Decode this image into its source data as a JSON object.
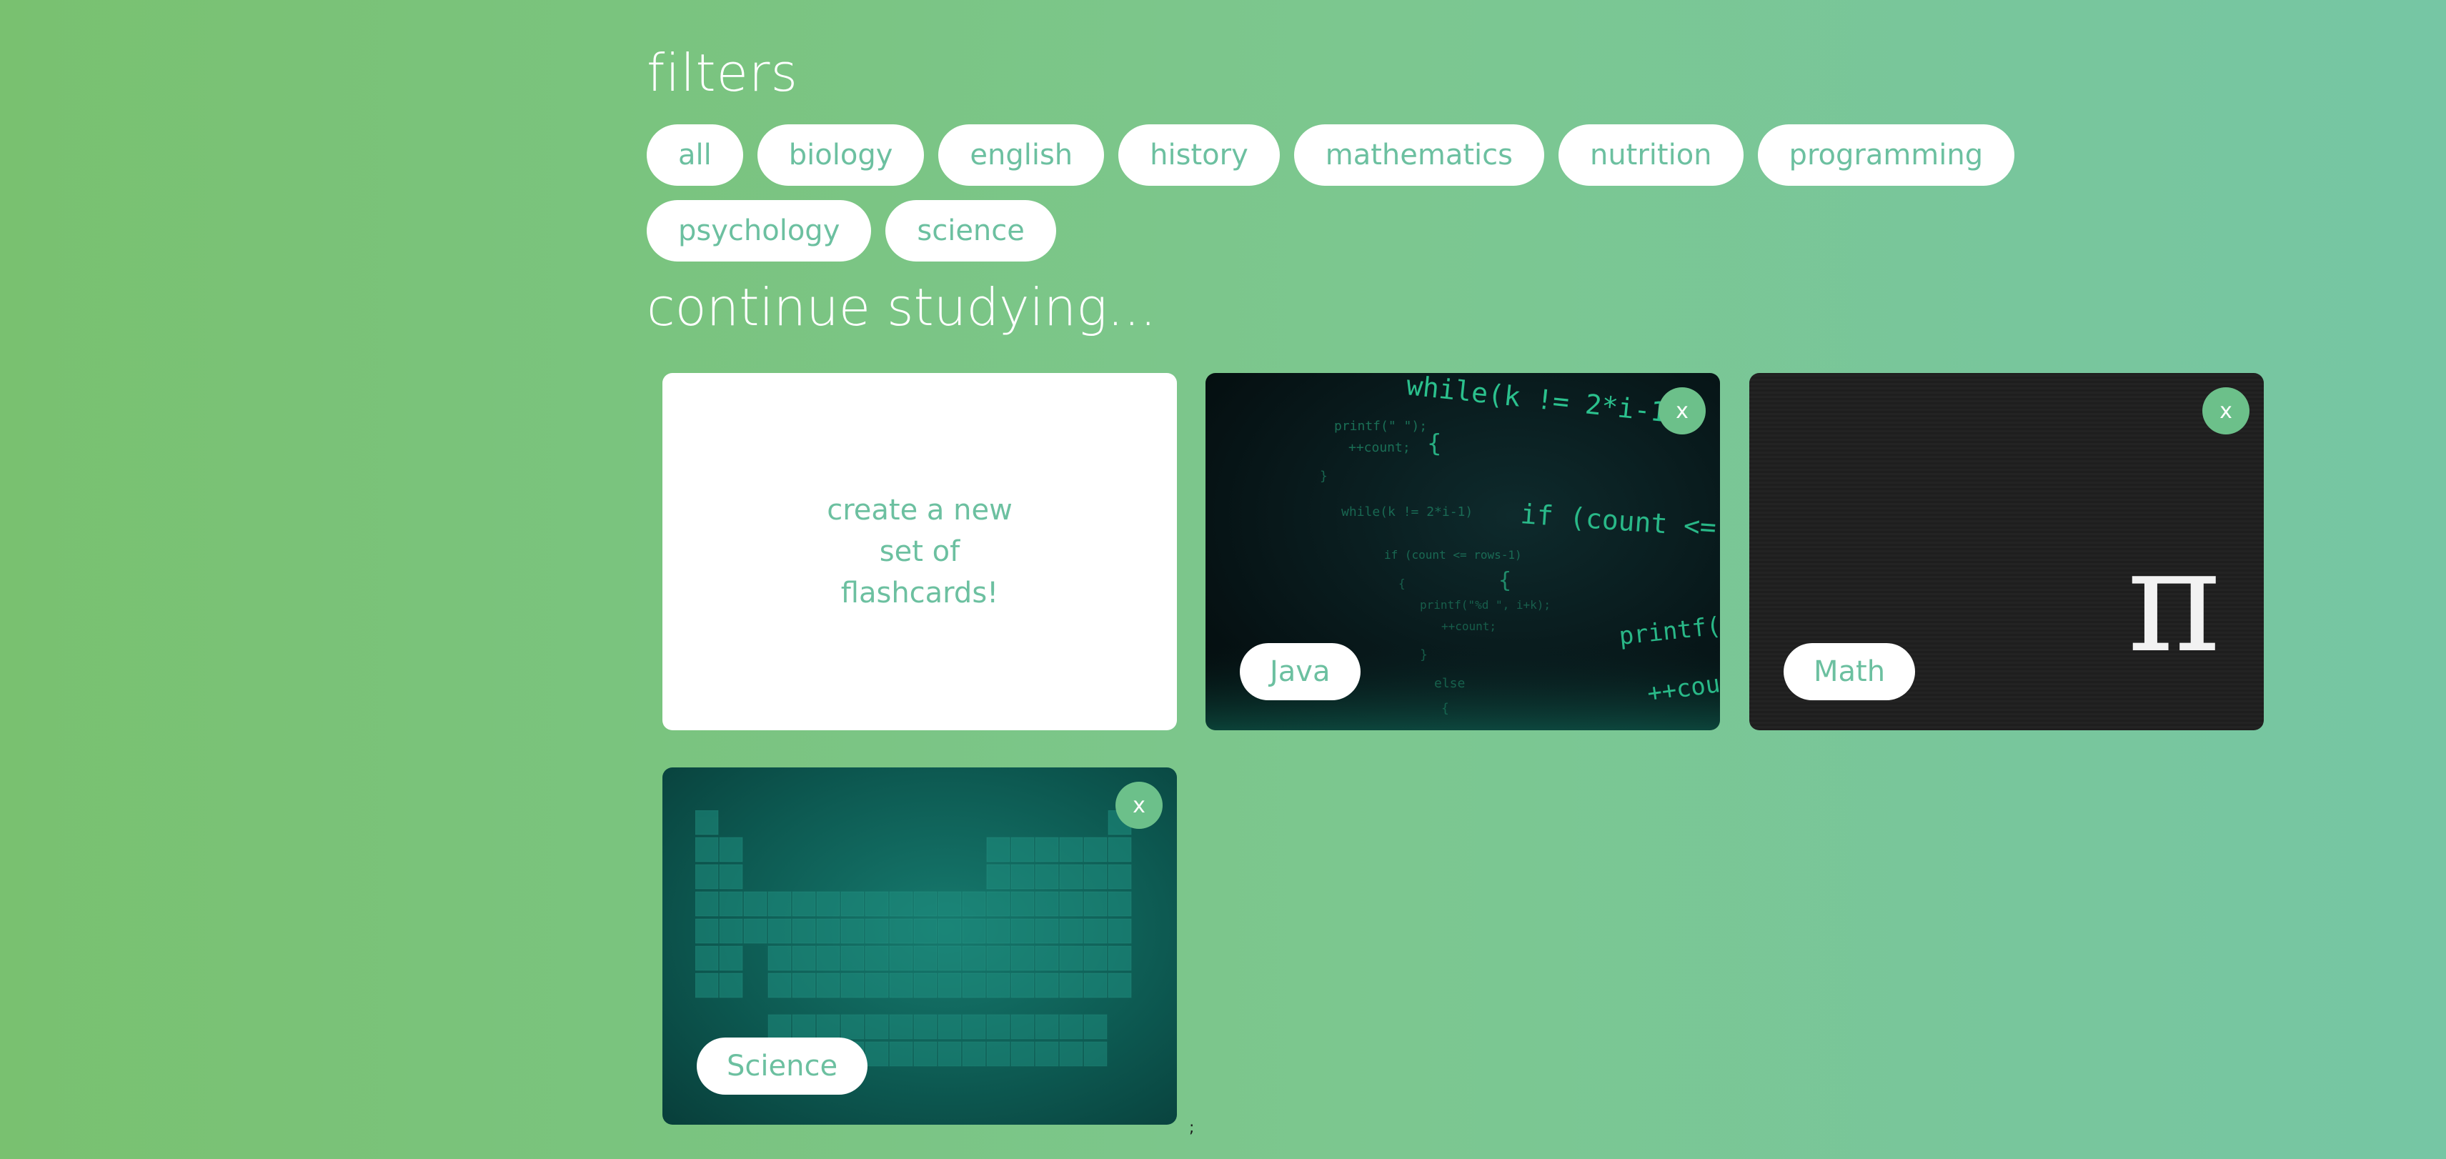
{
  "filters": {
    "title": "filters",
    "chips": [
      "all",
      "biology",
      "english",
      "history",
      "mathematics",
      "nutrition",
      "programming",
      "psychology",
      "science"
    ]
  },
  "continue": {
    "title": "continue studying..."
  },
  "cards": {
    "create": {
      "text": "create a new set of flashcards!"
    },
    "java": {
      "label": "Java",
      "close": "x"
    },
    "math": {
      "label": "Math",
      "close": "x",
      "symbol": "π"
    },
    "science": {
      "label": "Science",
      "close": "x"
    }
  },
  "stray_text": ";",
  "colors": {
    "accent": "#6cc0a0",
    "close_button": "#6cc08a",
    "background_start": "#79c170",
    "background_end": "#76c6a4"
  },
  "icons": {
    "close": "close-icon"
  }
}
